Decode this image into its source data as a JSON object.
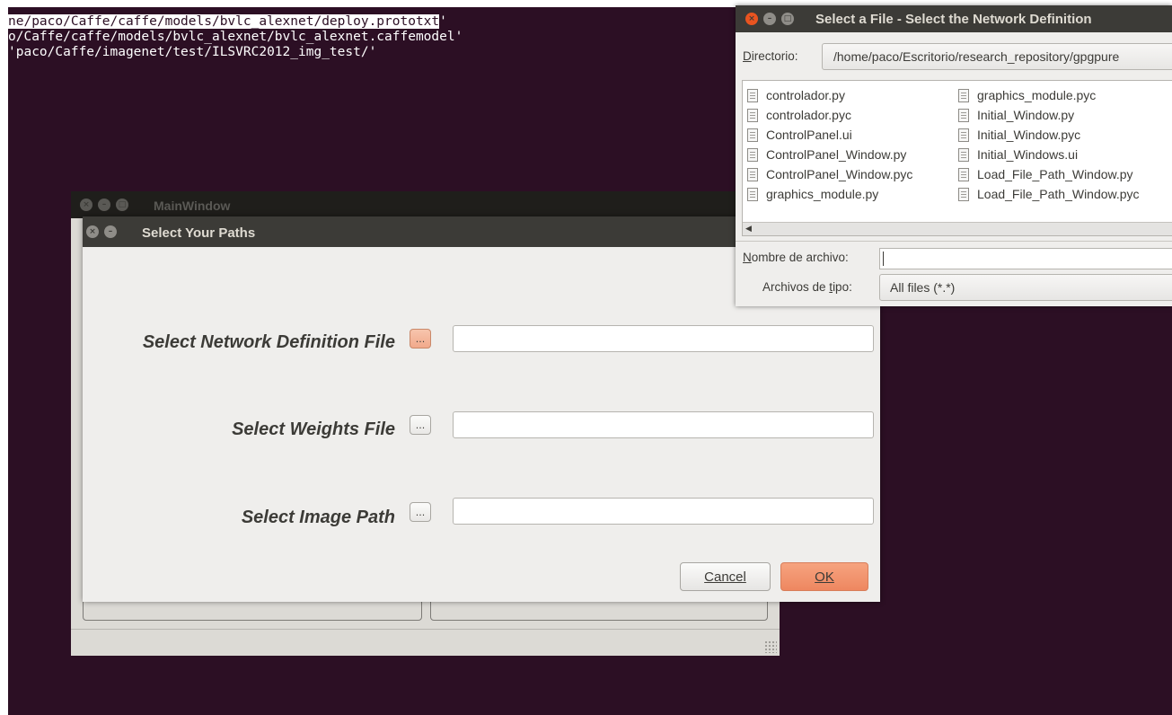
{
  "terminal": {
    "lines": [
      "ne/paco/Caffe/caffe/models/bvlc_alexnet/deploy.prototxt",
      "o/Caffe/caffe/models/bvlc_alexnet/bvlc_alexnet.caffemodel'",
      "'paco/Caffe/imagenet/test/ILSVRC2012_img_test/'"
    ],
    "line0_tail": "'"
  },
  "main_window": {
    "title": "MainWindow"
  },
  "paths_dialog": {
    "title": "Select Your Paths",
    "rows": [
      {
        "label": "Select Network Definition File",
        "browse": "...",
        "value": ""
      },
      {
        "label": "Select Weights File",
        "browse": "...",
        "value": ""
      },
      {
        "label": "Select Image Path",
        "browse": "...",
        "value": ""
      }
    ],
    "cancel_label": "Cancel",
    "ok_label": "OK"
  },
  "file_chooser": {
    "title": "Select a File - Select the Network Definition",
    "directory_label_u": "D",
    "directory_label_rest": "irectorio:",
    "directory_value": "/home/paco/Escritorio/research_repository/gpgpure",
    "files": [
      "controlador.py",
      "controlador.pyc",
      "ControlPanel.ui",
      "ControlPanel_Window.py",
      "ControlPanel_Window.pyc",
      "graphics_module.py",
      "graphics_module.pyc",
      "Initial_Window.py",
      "Initial_Window.pyc",
      "Initial_Windows.ui",
      "Load_File_Path_Window.py",
      "Load_File_Path_Window.pyc"
    ],
    "filename_label_u": "N",
    "filename_label_rest": "ombre de archivo:",
    "filename_value": "",
    "filetype_label_a": "Archivos de ",
    "filetype_label_u": "t",
    "filetype_label_b": "ipo:",
    "filetype_value": "All files (*.*)"
  },
  "colors": {
    "desktop": "#2c0f24",
    "accent_ok": "#ee8760",
    "close_button": "#e95420"
  }
}
